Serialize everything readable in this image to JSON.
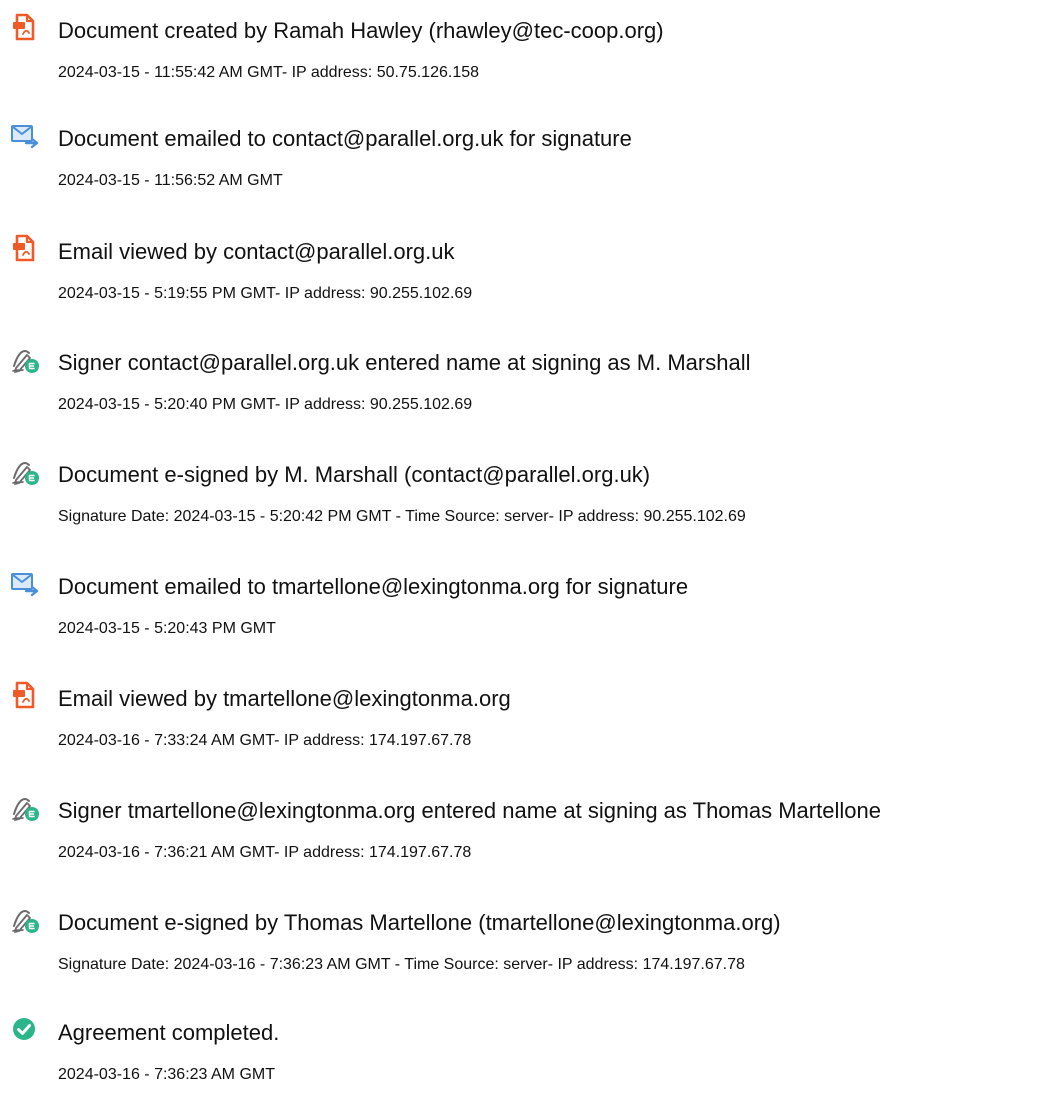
{
  "colors": {
    "document_icon": "#f05a28",
    "email_icon": "#4a90d9",
    "signer_icon": "#6c6c6c",
    "signer_badge": "#2bb58a",
    "completed_icon": "#2bb58a"
  },
  "events": [
    {
      "icon": "document-icon",
      "title": "Document created by Ramah Hawley (rhawley@tec-coop.org)",
      "detail": "2024-03-15 - 11:55:42 AM GMT- IP address: 50.75.126.158"
    },
    {
      "icon": "email-send-icon",
      "title": "Document emailed to contact@parallel.org.uk for signature",
      "detail": "2024-03-15 - 11:56:52 AM GMT"
    },
    {
      "icon": "document-icon",
      "title": "Email viewed by contact@parallel.org.uk",
      "detail": "2024-03-15 - 5:19:55 PM GMT- IP address: 90.255.102.69"
    },
    {
      "icon": "pen-signature-icon",
      "title": "Signer contact@parallel.org.uk entered name at signing as M. Marshall",
      "detail": "2024-03-15 - 5:20:40 PM GMT- IP address: 90.255.102.69"
    },
    {
      "icon": "pen-signature-icon",
      "title": "Document e-signed by M. Marshall (contact@parallel.org.uk)",
      "detail": "Signature Date: 2024-03-15 - 5:20:42 PM GMT - Time Source: server- IP address: 90.255.102.69"
    },
    {
      "icon": "email-send-icon",
      "title": "Document emailed to tmartellone@lexingtonma.org for signature",
      "detail": "2024-03-15 - 5:20:43 PM GMT"
    },
    {
      "icon": "document-icon",
      "title": "Email viewed by tmartellone@lexingtonma.org",
      "detail": "2024-03-16 - 7:33:24 AM GMT- IP address: 174.197.67.78"
    },
    {
      "icon": "pen-signature-icon",
      "title": "Signer tmartellone@lexingtonma.org entered name at signing as Thomas Martellone",
      "detail": "2024-03-16 - 7:36:21 AM GMT- IP address: 174.197.67.78"
    },
    {
      "icon": "pen-signature-icon",
      "title": "Document e-signed by Thomas Martellone (tmartellone@lexingtonma.org)",
      "detail": "Signature Date: 2024-03-16 - 7:36:23 AM GMT - Time Source: server- IP address: 174.197.67.78"
    },
    {
      "icon": "checkmark-circle-icon",
      "title": "Agreement completed.",
      "detail": "2024-03-16 - 7:36:23 AM GMT"
    }
  ]
}
